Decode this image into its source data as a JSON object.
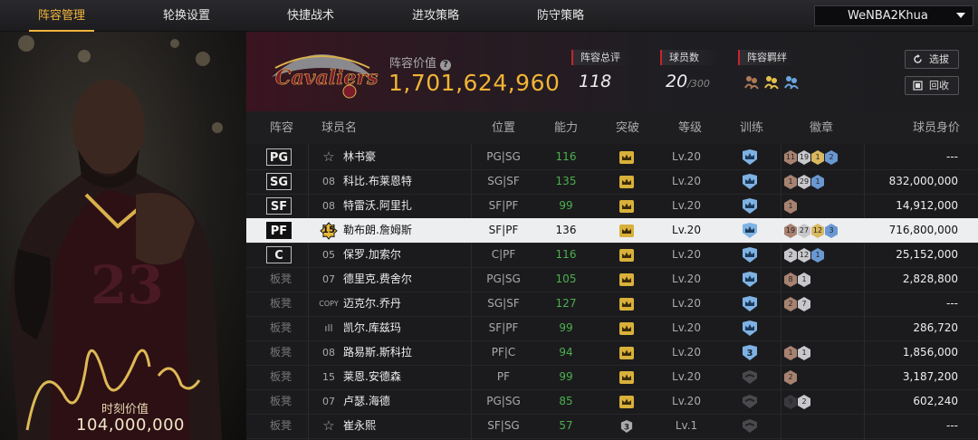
{
  "nav": {
    "tabs": [
      {
        "label": "阵容管理",
        "active": true
      },
      {
        "label": "轮换设置",
        "active": false
      },
      {
        "label": "快捷战术",
        "active": false
      },
      {
        "label": "进攻策略",
        "active": false
      },
      {
        "label": "防守策略",
        "active": false
      }
    ],
    "user": "WeNBA2Khua"
  },
  "card": {
    "label": "时刻价值",
    "value": "104,000,000"
  },
  "summary": {
    "lineup_value_label": "阵容价值",
    "lineup_value": "1,701,624,960",
    "overall_label": "阵容总评",
    "overall_value": "118",
    "players_label": "球员数",
    "players_value": "20",
    "players_max": "/300",
    "chem_label": "阵容羁绊",
    "select_button": "选拔",
    "recycle_button": "回收"
  },
  "columns": {
    "lineup": "阵容",
    "name": "球员名",
    "position": "位置",
    "ability": "能力",
    "breakthrough": "突破",
    "level": "等级",
    "training": "训练",
    "badges": "徽章",
    "value": "球员身价"
  },
  "rows": [
    {
      "slot": "PG",
      "num": "☆",
      "name": "林书豪",
      "position": "PG|SG",
      "ability": "116",
      "level": "Lv.20",
      "value": "---",
      "bk": "gold",
      "train": "blue",
      "badges": [
        {
          "c": "bronze",
          "t": "11"
        },
        {
          "c": "silver",
          "t": "19"
        },
        {
          "c": "gold",
          "t": "1"
        },
        {
          "c": "blue",
          "t": "2"
        }
      ]
    },
    {
      "slot": "SG",
      "num": "08",
      "name": "科比.布莱恩特",
      "position": "SG|SF",
      "ability": "135",
      "level": "Lv.20",
      "value": "832,000,000",
      "bk": "gold",
      "train": "blue",
      "badges": [
        {
          "c": "bronze",
          "t": "1"
        },
        {
          "c": "silver",
          "t": "29"
        },
        {
          "c": "blue",
          "t": "1"
        }
      ]
    },
    {
      "slot": "SF",
      "num": "08",
      "name": "特雷沃.阿里扎",
      "position": "SF|PF",
      "ability": "99",
      "level": "Lv.20",
      "value": "14,912,000",
      "bk": "gold",
      "train": "blue",
      "badges": [
        {
          "c": "bronze",
          "t": "1"
        }
      ]
    },
    {
      "slot": "PF",
      "num": "15",
      "name": "勒布朗.詹姆斯",
      "position": "SF|PF",
      "ability": "136",
      "level": "Lv.20",
      "value": "716,800,000",
      "bk": "gold",
      "train": "blue",
      "badges": [
        {
          "c": "bronze",
          "t": "19"
        },
        {
          "c": "silver",
          "t": "27"
        },
        {
          "c": "gold",
          "t": "12"
        },
        {
          "c": "blue",
          "t": "3"
        }
      ],
      "selected": true
    },
    {
      "slot": "C",
      "num": "05",
      "name": "保罗.加索尔",
      "position": "C|PF",
      "ability": "116",
      "level": "Lv.20",
      "value": "25,152,000",
      "bk": "gold",
      "train": "blue",
      "badges": [
        {
          "c": "silver",
          "t": "2"
        },
        {
          "c": "silver",
          "t": "12"
        },
        {
          "c": "blue",
          "t": "1"
        }
      ]
    },
    {
      "slot": "板凳",
      "num": "07",
      "name": "德里克.费舍尔",
      "position": "PG|SG",
      "ability": "105",
      "level": "Lv.20",
      "value": "2,828,800",
      "bk": "gold",
      "train": "blue",
      "badges": [
        {
          "c": "bronze",
          "t": "8"
        },
        {
          "c": "silver",
          "t": "1"
        }
      ]
    },
    {
      "slot": "板凳",
      "num": "COPY",
      "name": "迈克尔.乔丹",
      "position": "SG|SF",
      "ability": "127",
      "level": "Lv.20",
      "value": "---",
      "bk": "gold",
      "train": "blue",
      "badges": [
        {
          "c": "bronze",
          "t": "2"
        },
        {
          "c": "silver",
          "t": "7"
        }
      ]
    },
    {
      "slot": "板凳",
      "num": "ıll",
      "name": "凯尔.库兹玛",
      "position": "SF|PF",
      "ability": "99",
      "level": "Lv.20",
      "value": "286,720",
      "bk": "gold",
      "train": "blue",
      "badges": []
    },
    {
      "slot": "板凳",
      "num": "08",
      "name": "路易斯.斯科拉",
      "position": "PF|C",
      "ability": "94",
      "level": "Lv.20",
      "value": "1,856,000",
      "bk": "gold",
      "train": "blue3",
      "badges": [
        {
          "c": "bronze",
          "t": "1"
        },
        {
          "c": "silver",
          "t": "1"
        }
      ]
    },
    {
      "slot": "板凳",
      "num": "15",
      "name": "莱恩.安德森",
      "position": "PF",
      "ability": "99",
      "level": "Lv.20",
      "value": "3,187,200",
      "bk": "gold",
      "train": "gray",
      "badges": [
        {
          "c": "bronze",
          "t": "2"
        }
      ]
    },
    {
      "slot": "板凳",
      "num": "07",
      "name": "卢瑟.海德",
      "position": "PG|SG",
      "ability": "85",
      "level": "Lv.20",
      "value": "602,240",
      "bk": "gold",
      "train": "gray",
      "badges": [
        {
          "c": "dark",
          "t": "9"
        },
        {
          "c": "silver",
          "t": "2"
        }
      ]
    },
    {
      "slot": "板凳",
      "num": "☆",
      "name": "崔永熙",
      "position": "SF|SG",
      "ability": "57",
      "level": "Lv.1",
      "value": "---",
      "bk": "gray3",
      "train": "gray",
      "badges": []
    }
  ]
}
